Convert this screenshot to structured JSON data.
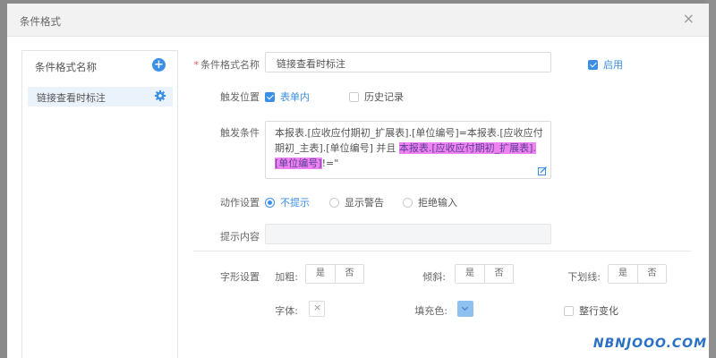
{
  "dialog": {
    "title": "条件格式",
    "close": "×"
  },
  "left": {
    "header": "条件格式名称",
    "add": "+",
    "items": [
      {
        "label": "链接查看时标注"
      }
    ]
  },
  "form": {
    "name": {
      "required": "*",
      "label": "条件格式名称",
      "value": "链接查看时标注"
    },
    "enable": {
      "label": "启用",
      "checked": true
    },
    "trigger_pos": {
      "label": "触发位置",
      "opt1": "表单内",
      "opt1_checked": true,
      "opt2": "历史记录",
      "opt2_checked": false
    },
    "trigger_cond": {
      "label": "触发条件",
      "text1": "本报表.[应收应付期初_扩展表].[单位编号]=本报表.[应收应付期初_主表].[单位编号] 并且 ",
      "highlight": "本报表.[应收应付期初_扩展表].[单位编号]",
      "text2": "!=\""
    },
    "action": {
      "label": "动作设置",
      "options": [
        "不提示",
        "显示警告",
        "拒绝输入"
      ],
      "selected": 0
    },
    "prompt": {
      "label": "提示内容",
      "value": ""
    },
    "font_style": {
      "label": "字形设置",
      "bold": {
        "label": "加粗:",
        "yes": "是",
        "no": "否"
      },
      "italic": {
        "label": "倾斜:",
        "yes": "是",
        "no": "否"
      },
      "underline": {
        "label": "下划线:",
        "yes": "是",
        "no": "否"
      }
    },
    "font": {
      "label": "字体:"
    },
    "fill": {
      "label": "填充色:",
      "color": "#8fc1f0"
    },
    "row_change": {
      "label": "整行变化",
      "checked": false
    }
  },
  "watermark": {
    "text": "NBNJOOO.COM"
  },
  "colors": {
    "accent": "#3b8fe6",
    "highlight": "#ee82ee"
  }
}
